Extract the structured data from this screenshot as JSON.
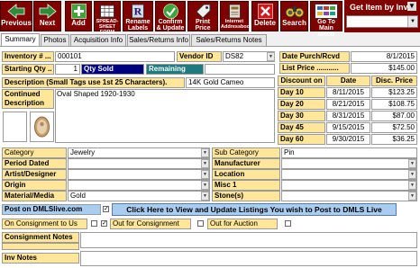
{
  "toolbar": {
    "previous": "Previous",
    "next": "Next",
    "add": "Add",
    "spreadsheet_form": "SPREAD-SHEET FORM",
    "rename_labels": "Rename Labels",
    "confirm_update": "Confirm & Update",
    "print_price_tags": "Print Price Tags",
    "internet_addressbook": "Internet Addressbook",
    "delete": "Delete",
    "search": "Search",
    "go_to_main_menu": "Go To Main Menu",
    "get_item_by": "Get Item by Inv #"
  },
  "tabs": [
    "Summary",
    "Photos",
    "Acquisition Info",
    "Sales/Returns Info",
    "Sales/Returns Notes"
  ],
  "item": {
    "inventory_label": "Inventory # ...",
    "inventory_value": "000101",
    "vendor_id_label": "Vendor ID",
    "vendor_id_value": "DS82",
    "starting_qty_label": "Starting Qty ..",
    "starting_qty_value": "1",
    "qty_sold_label": "Qty Sold",
    "remaining_label": "Remaining",
    "date_purch_label": "Date Purch/Rcvd",
    "date_purch_value": "8/1/2015",
    "list_price_label": "List  Price ...........",
    "list_price_value": "$145.00",
    "description_label": "Description (Small Tags use 1st 25 Characters).",
    "description_value": "14K Gold Cameo",
    "continued_desc_label": "Continued Description",
    "continued_desc_value": "Oval Shaped 1920-1930"
  },
  "discounts": {
    "headers": [
      "Discount on",
      "Date",
      "Disc. Price"
    ],
    "rows": [
      {
        "day": "Day  10",
        "date": "8/11/2015",
        "price": "$123.25"
      },
      {
        "day": "Day  20",
        "date": "8/21/2015",
        "price": "$108.75"
      },
      {
        "day": "Day  30",
        "date": "8/31/2015",
        "price": "$87.00"
      },
      {
        "day": "Day  45",
        "date": "9/15/2015",
        "price": "$72.50"
      },
      {
        "day": "Day  60",
        "date": "9/30/2015",
        "price": "$36.25"
      }
    ]
  },
  "attributes": {
    "category_label": "Category",
    "category_value": "Jewelry",
    "sub_category_label": "Sub Category",
    "sub_category_value": "Pin",
    "period_dated_label": "Period Dated",
    "manufacturer_label": "Manufacturer",
    "artist_designer_label": "Artist/Designer",
    "location_label": "Location",
    "origin_label": "Origin",
    "misc1_label": "Misc 1",
    "material_label": "Material/Media",
    "material_value": "Gold",
    "stones_label": "Stone(s)"
  },
  "dmls": {
    "post_label": "Post on DMLSlive.com",
    "button_label": "Click Here to View and Update Listings You wish to Post to DMLS Live"
  },
  "status": {
    "on_consignment_label": "On Consignment to Us",
    "out_for_consignment_label": "Out for Consignment",
    "out_for_auction_label": "Out for Auction",
    "consignment_notes_label": "Consignment Notes",
    "inv_notes_label": "Inv Notes"
  },
  "colors": {
    "toolbar_maroon": "#800000",
    "label_yellow": "#ffe699",
    "label_purple": "#e0c8f0",
    "qty_sold_navy": "#00007f",
    "remaining_teal": "#1f7a80",
    "dmls_button_blue": "#a9cdf0"
  }
}
